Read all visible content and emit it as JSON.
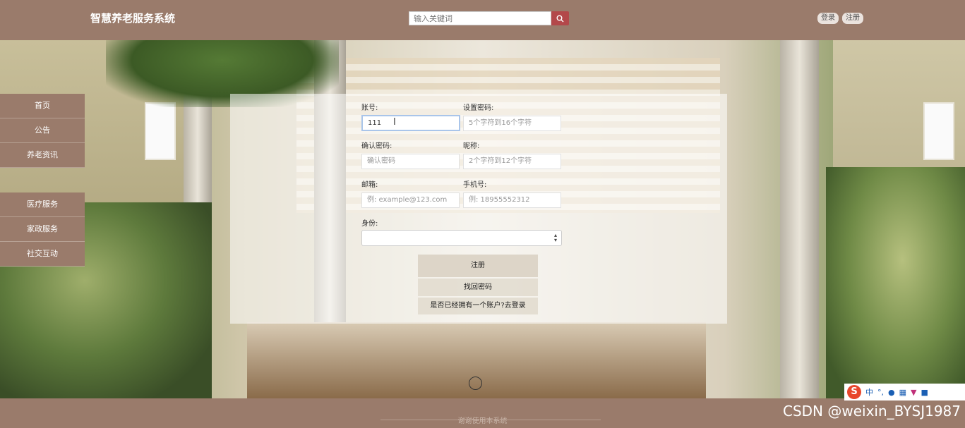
{
  "header": {
    "title": "智慧养老服务系统",
    "search_placeholder": "输入关键词",
    "login_label": "登录",
    "register_label": "注册"
  },
  "sidebar": {
    "items": [
      {
        "label": "首页"
      },
      {
        "label": "公告"
      },
      {
        "label": "养老资讯"
      },
      {
        "label": "医疗服务"
      },
      {
        "label": "家政服务"
      },
      {
        "label": "社交互动"
      }
    ]
  },
  "form": {
    "account_label": "账号:",
    "account_value": "111",
    "password_label": "设置密码:",
    "password_placeholder": "5个字符到16个字符",
    "confirm_label": "确认密码:",
    "confirm_placeholder": "确认密码",
    "nickname_label": "昵称:",
    "nickname_placeholder": "2个字符到12个字符",
    "email_label": "邮箱:",
    "email_placeholder": "例: example@123.com",
    "phone_label": "手机号:",
    "phone_placeholder": "例: 18955552312",
    "role_label": "身份:",
    "role_value": "",
    "register_button": "注册",
    "recover_button": "找回密码",
    "login_link": "是否已经拥有一个账户?去登录"
  },
  "footer": {
    "text": "谢谢使用本系统"
  },
  "overlay": {
    "watermark": "CSDN @weixin_BYSJ1987",
    "ime_text": "中"
  },
  "colors": {
    "header_bg": "#9a7b6b",
    "search_button": "#b3484a",
    "button_bg": "#ddd5c8"
  }
}
